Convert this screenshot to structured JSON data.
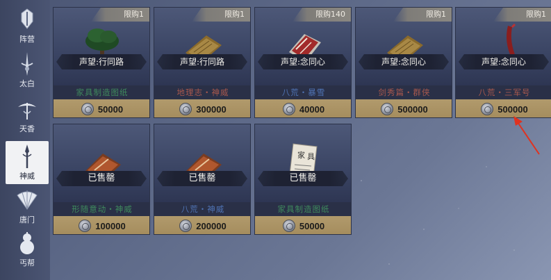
{
  "sidebar": {
    "items": [
      {
        "label": "阵营",
        "icon": "sword-emblem-icon",
        "active": false
      },
      {
        "label": "太白",
        "icon": "taibai-sword-icon",
        "active": false
      },
      {
        "label": "天香",
        "icon": "tianxiang-umbrella-icon",
        "active": false
      },
      {
        "label": "神威",
        "icon": "shenwei-spear-icon",
        "active": true
      },
      {
        "label": "唐门",
        "icon": "tangmen-fan-icon",
        "active": false
      },
      {
        "label": "丐帮",
        "icon": "gourd-icon",
        "active": false
      }
    ]
  },
  "shop": {
    "items": [
      {
        "limit": "限购1",
        "requirement": "声望:行同路",
        "name": "家具制造图纸",
        "name_color": "#3f8a5d",
        "price": "50000",
        "art": "tree-bonsai-icon"
      },
      {
        "limit": "限购1",
        "requirement": "声望:行同路",
        "name": "地理志・神威",
        "name_color": "#a8584d",
        "price": "300000",
        "art": "book-scroll-icon"
      },
      {
        "limit": "限购140",
        "requirement": "声望:念同心",
        "name": "八荒・暴雪",
        "name_color": "#4f73b4",
        "price": "40000",
        "art": "red-book-icon"
      },
      {
        "limit": "限购1",
        "requirement": "声望:念同心",
        "name": "剑秀篇・群侠",
        "name_color": "#a8584d",
        "price": "500000",
        "art": "book-scroll-icon"
      },
      {
        "limit": "限购1",
        "requirement": "声望:念同心",
        "name": "八荒・三军号",
        "name_color": "#a8584d",
        "price": "500000",
        "art": "red-horn-icon"
      },
      {
        "limit": "",
        "requirement": "已售罄",
        "name": "形随意动・神威",
        "name_color": "#3f8a5d",
        "price": "100000",
        "art": "red-manual-icon"
      },
      {
        "limit": "",
        "requirement": "已售罄",
        "name": "八荒・神威",
        "name_color": "#4f73b4",
        "price": "200000",
        "art": "red-manual-icon"
      },
      {
        "limit": "",
        "requirement": "已售罄",
        "name": "家具制造图纸",
        "name_color": "#3f8a5d",
        "price": "50000",
        "art": "paper-scroll-icon"
      }
    ]
  },
  "annotation": {
    "color": "#e0321f"
  }
}
